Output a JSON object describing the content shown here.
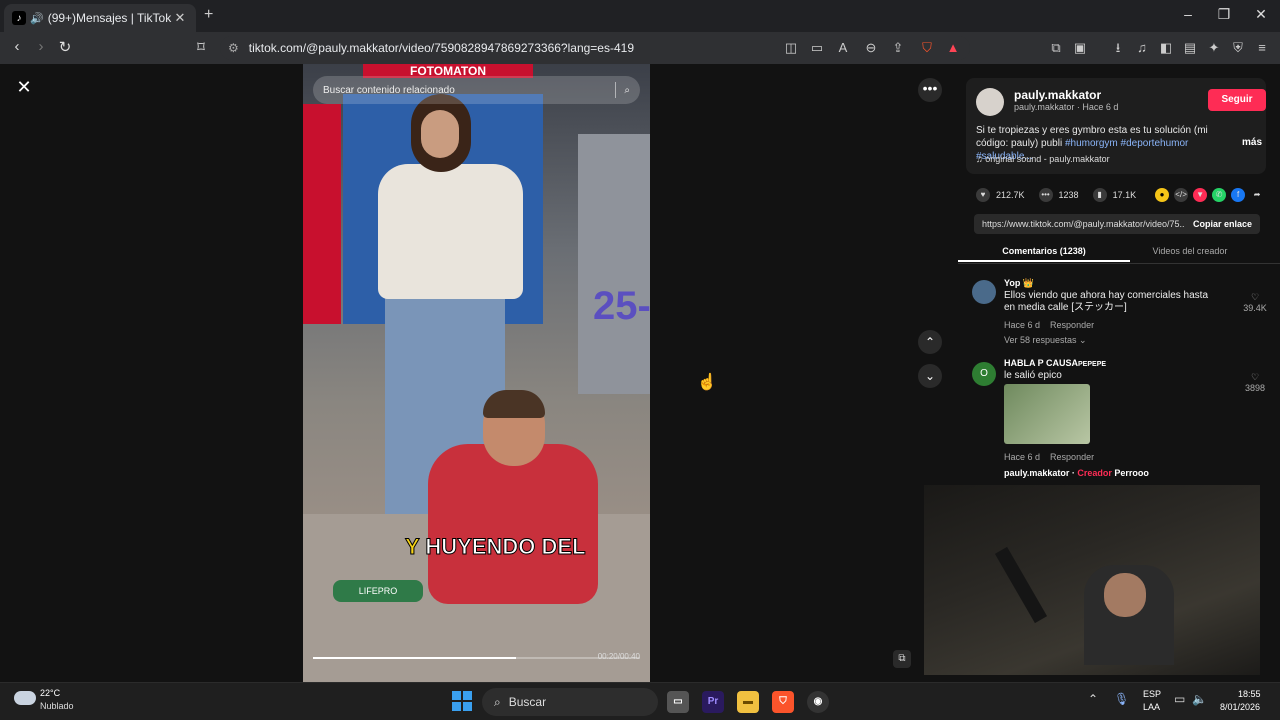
{
  "browser": {
    "tab_title": "(99+)Mensajes | TikTok",
    "tab_favicon": "tiktok-logo",
    "new_tab_label": "+",
    "url": "tiktok.com/@pauly.makkator/video/7590828947869273366?lang=es-419",
    "window_controls": [
      "minimize",
      "maximize",
      "close"
    ]
  },
  "video": {
    "search_placeholder": "Buscar contenido relacionado",
    "sign_text": "FOTOMATON",
    "graffiti_text": "25-",
    "caption_highlight": "Y",
    "caption_rest": " HUYENDO DEL",
    "bottle_brand": "LIFEPRO",
    "timestamp": "00:20/00:40",
    "progress": 0.62
  },
  "post": {
    "author_name": "pauly.makkator",
    "author_meta": "pauly.makkator · Hace 6 d",
    "follow_label": "Seguir",
    "description": "Si te tropiezas y eres gymbro esta es tu solución (mi código: pauly) publi ",
    "hashtags": "#humorgym #deportehumor #saludable...",
    "more_label": "más",
    "sound": "original sound - pauly.makkator",
    "likes": "212.7K",
    "comments_count": "1238",
    "saves": "17.1K",
    "share_link": "https://www.tiktok.com/@pauly.makkator/video/75...",
    "copy_label": "Copiar enlace",
    "tab_comments": "Comentarios (1238)",
    "tab_creator": "Videos del creador"
  },
  "comments": [
    {
      "user": "Yop 👑",
      "text": "Ellos viendo que ahora hay comerciales hasta en media calle [ステッカー]",
      "time": "Hace 6 d",
      "reply_label": "Responder",
      "likes": "39.4K",
      "replies": "Ver 58 respuestas ⌄"
    },
    {
      "user": "HABLA P CAUSA",
      "badge": "PEPEPE",
      "text": "le salió epico",
      "time": "Hace 6 d",
      "reply_label": "Responder",
      "likes": "3898",
      "reply_user": "pauly.makkator",
      "reply_creator": "Creador",
      "reply_text": "Perrooo"
    }
  ],
  "taskbar": {
    "weather_temp": "22°C",
    "weather_desc": "Nublado",
    "search_label": "Buscar",
    "lang_line1": "ESP",
    "lang_line2": "LAA",
    "time": "18:55",
    "date": "8/01/2026",
    "apps": [
      "premiere-pro",
      "file-explorer",
      "brave-browser",
      "obs"
    ]
  },
  "colors": {
    "follow_button": "#fe2c55",
    "hashtag": "#8ab4f8",
    "caption_highlight": "#f7d417",
    "creator_tag": "#fe2c55"
  }
}
